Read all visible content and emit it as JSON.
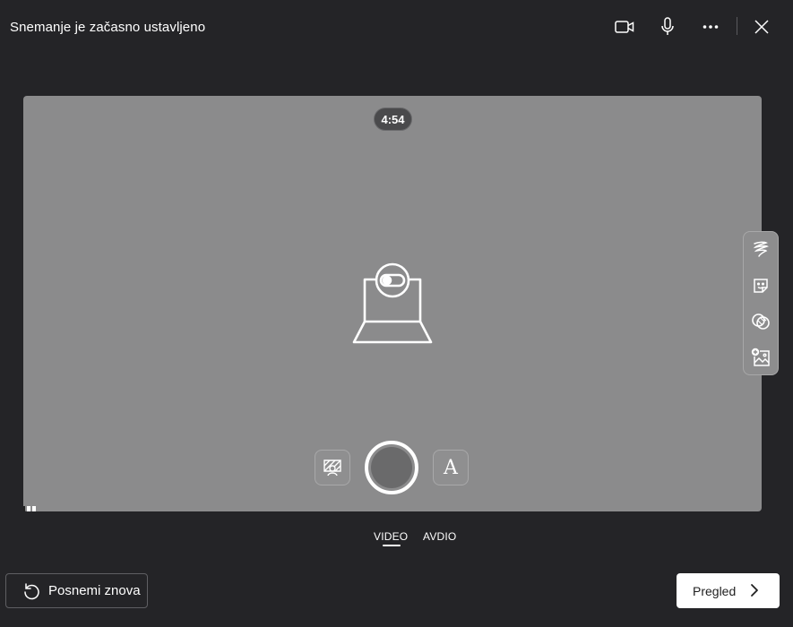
{
  "header": {
    "title": "Snemanje je začasno ustavljeno",
    "icons": [
      "camera-icon",
      "microphone-icon",
      "more-icon",
      "close-icon"
    ]
  },
  "preview": {
    "timer": "4:54",
    "camera_state_icon": "camera-off-icon"
  },
  "side_toolbar": {
    "tools": [
      "pen-icon",
      "sticker-icon",
      "filter-icon",
      "add-image-icon"
    ]
  },
  "capture_controls": {
    "left_icon": "backdrop-icon",
    "text_label": "A",
    "record_icon": "record-icon"
  },
  "mode_tabs": [
    {
      "label": "VIDEO",
      "selected": true
    },
    {
      "label": "AVDIO",
      "selected": false
    }
  ],
  "footer": {
    "retake_label": "Posnemi znova",
    "review_label": "Pregled"
  },
  "colors": {
    "background": "#242427",
    "preview": "#8b8b8c",
    "primary_button": "#ffffff"
  }
}
